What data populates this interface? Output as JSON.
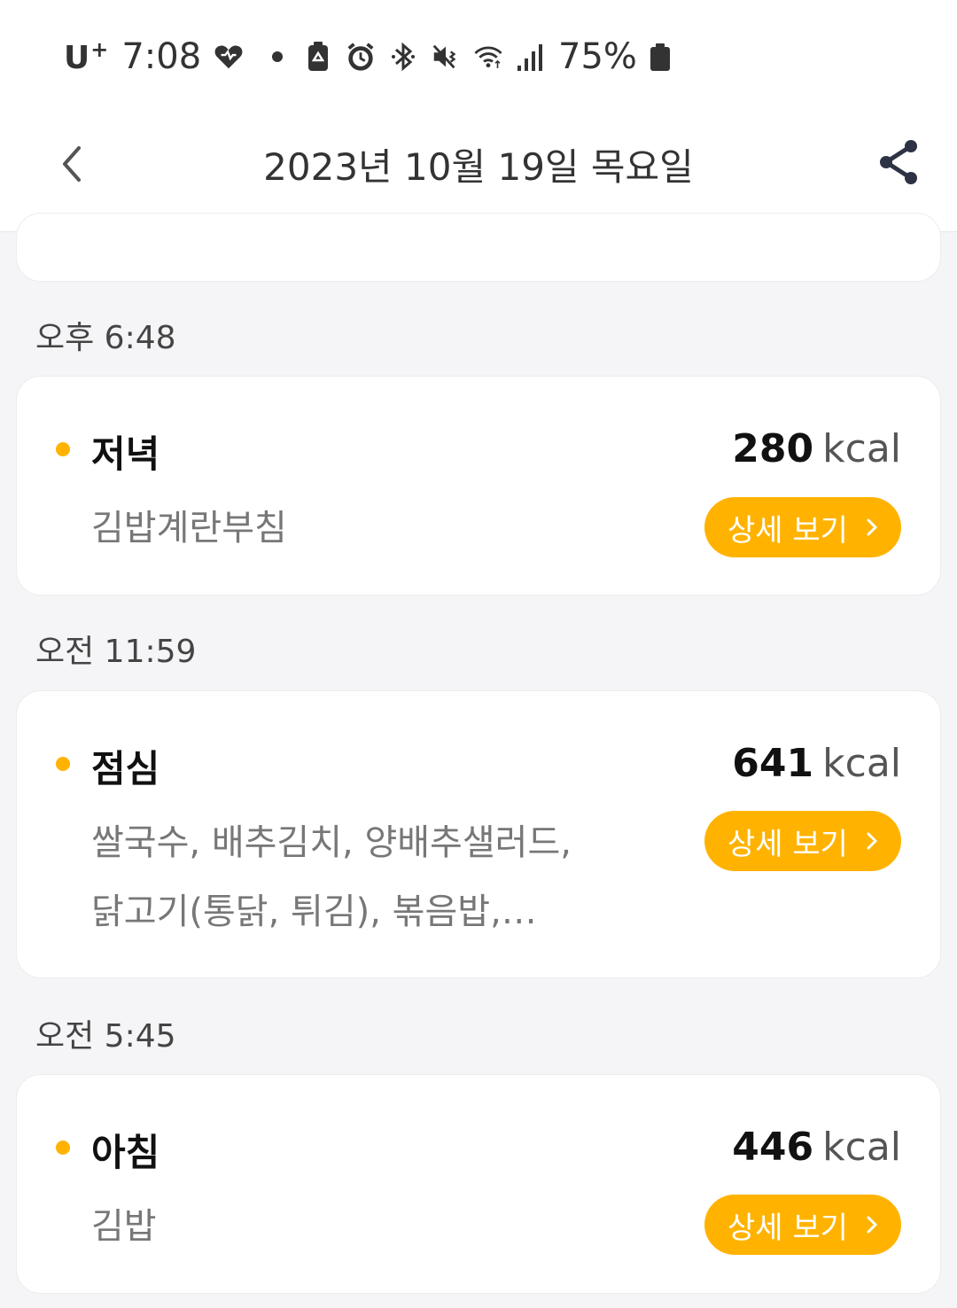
{
  "status_bar": {
    "carrier": "U",
    "carrier_sup": "+",
    "time": "7:08",
    "battery": "75%"
  },
  "header": {
    "title": "2023년 10월 19일 목요일"
  },
  "meals": [
    {
      "time": "오후 6:48",
      "name": "저녁",
      "kcal": "280",
      "unit": "kcal",
      "foods": [
        "김밥계란부침"
      ],
      "button": "상세 보기"
    },
    {
      "time": "오전 11:59",
      "name": "점심",
      "kcal": "641",
      "unit": "kcal",
      "foods": [
        "쌀국수, 배추김치, 양배추샐러드,",
        "닭고기(통닭, 튀김), 볶음밥,…"
      ],
      "button": "상세 보기"
    },
    {
      "time": "오전 5:45",
      "name": "아침",
      "kcal": "446",
      "unit": "kcal",
      "foods": [
        "김밥"
      ],
      "button": "상세 보기"
    }
  ],
  "colors": {
    "accent": "#ffb300",
    "background": "#f5f5f7"
  }
}
